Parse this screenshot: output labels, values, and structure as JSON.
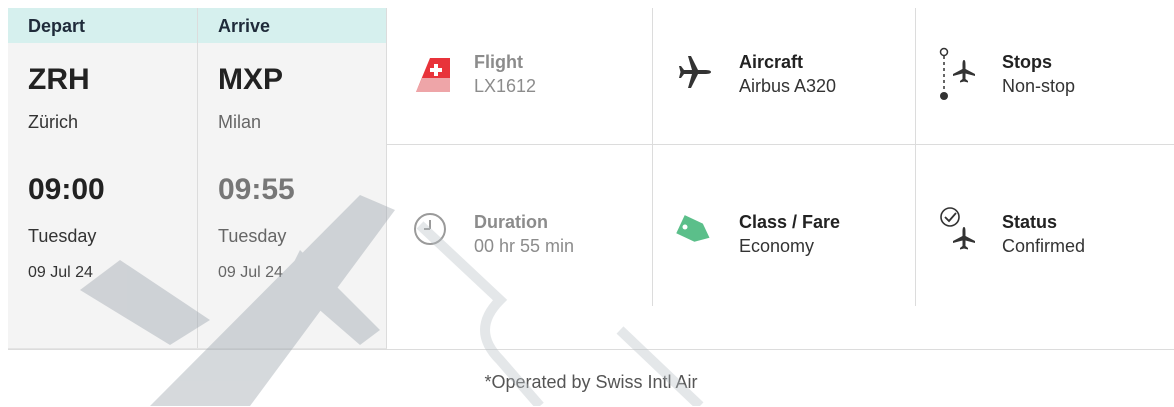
{
  "depart": {
    "label": "Depart",
    "code": "ZRH",
    "city": "Zürich",
    "time": "09:00",
    "day": "Tuesday",
    "date": "09 Jul 24"
  },
  "arrive": {
    "label": "Arrive",
    "code": "MXP",
    "city": "Milan",
    "time": "09:55",
    "day": "Tuesday",
    "date": "09 Jul 24"
  },
  "info": {
    "flight": {
      "title": "Flight",
      "value": "LX1612",
      "icon": "airline-tail-logo-icon"
    },
    "aircraft": {
      "title": "Aircraft",
      "value": "Airbus A320",
      "icon": "airplane-icon"
    },
    "stops": {
      "title": "Stops",
      "value": "Non-stop",
      "icon": "route-stops-icon"
    },
    "duration": {
      "title": "Duration",
      "value": "00 hr 55 min",
      "icon": "clock-icon"
    },
    "class_fare": {
      "title": "Class / Fare",
      "value": "Economy",
      "icon": "price-tag-icon"
    },
    "status": {
      "title": "Status",
      "value": "Confirmed",
      "icon": "check-plane-icon"
    }
  },
  "footer": {
    "operated_by": "*Operated by Swiss Intl Air"
  },
  "colors": {
    "header_bg": "#d6f0ee",
    "tag_green": "#5bbf8a",
    "swiss_red": "#e8333a"
  }
}
